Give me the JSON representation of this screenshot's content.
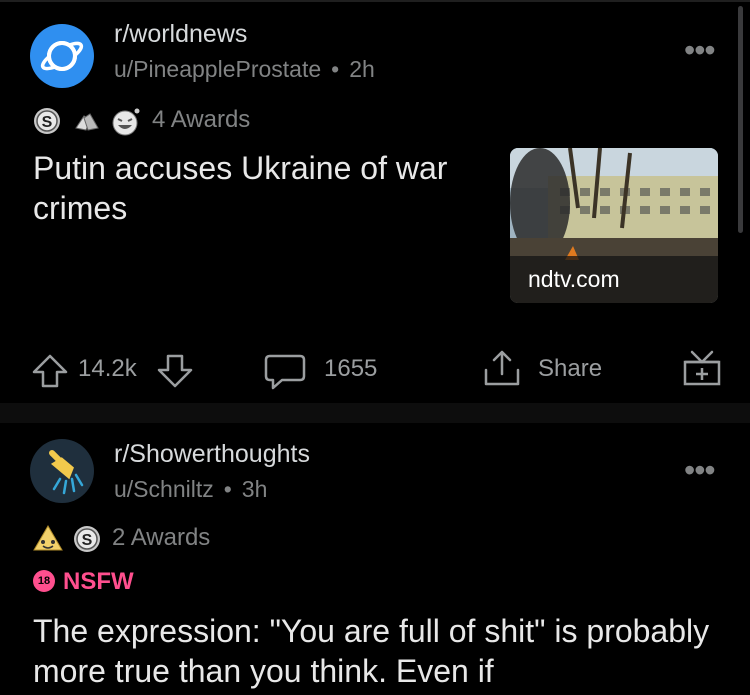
{
  "post1": {
    "subreddit": "r/worldnews",
    "user": "u/PineappleProstate",
    "time": "2h",
    "awards_label": "4 Awards",
    "title": "Putin accuses Ukraine of war crimes",
    "thumbnail_domain": "ndtv.com",
    "upvotes": "14.2k",
    "comments": "1655",
    "share_label": "Share"
  },
  "post2": {
    "subreddit": "r/Showerthoughts",
    "user": "u/Schniltz",
    "time": "3h",
    "awards_label": "2 Awards",
    "nsfw_label": "NSFW",
    "nsfw_badge": "18",
    "title": "The expression: \"You are full of shit\" is probably more true than you think. Even if"
  },
  "colors": {
    "background": "#000000",
    "worldnews_avatar": "#2f8ff0",
    "nsfw": "#ff4f8e",
    "icon_gray": "#9b9ea0"
  }
}
